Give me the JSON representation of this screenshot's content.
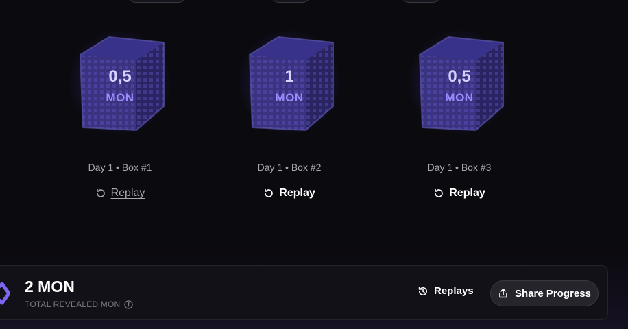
{
  "colors": {
    "background": "#0b0a0e",
    "cube_face": "#3a3380",
    "cube_glow": "#4c36c8",
    "accent_text": "#9a8cff",
    "muted_text": "#a9a7b0"
  },
  "boxes": [
    {
      "amount": "0,5",
      "unit": "MON",
      "caption": "Day 1 • Box #1",
      "replay_label": "Replay",
      "replay_state": "hover"
    },
    {
      "amount": "1",
      "unit": "MON",
      "caption": "Day 1 • Box #2",
      "replay_label": "Replay",
      "replay_state": "default"
    },
    {
      "amount": "0,5",
      "unit": "MON",
      "caption": "Day 1 • Box #3",
      "replay_label": "Replay",
      "replay_state": "default"
    }
  ],
  "summary": {
    "total_value": "2 MON",
    "total_label": "TOTAL REVEALED MON",
    "info_icon": "info-icon",
    "replays_label": "Replays",
    "replays_icon": "history-icon",
    "share_label": "Share Progress",
    "share_icon": "share-icon",
    "logo_icon": "monad-logo-icon"
  }
}
